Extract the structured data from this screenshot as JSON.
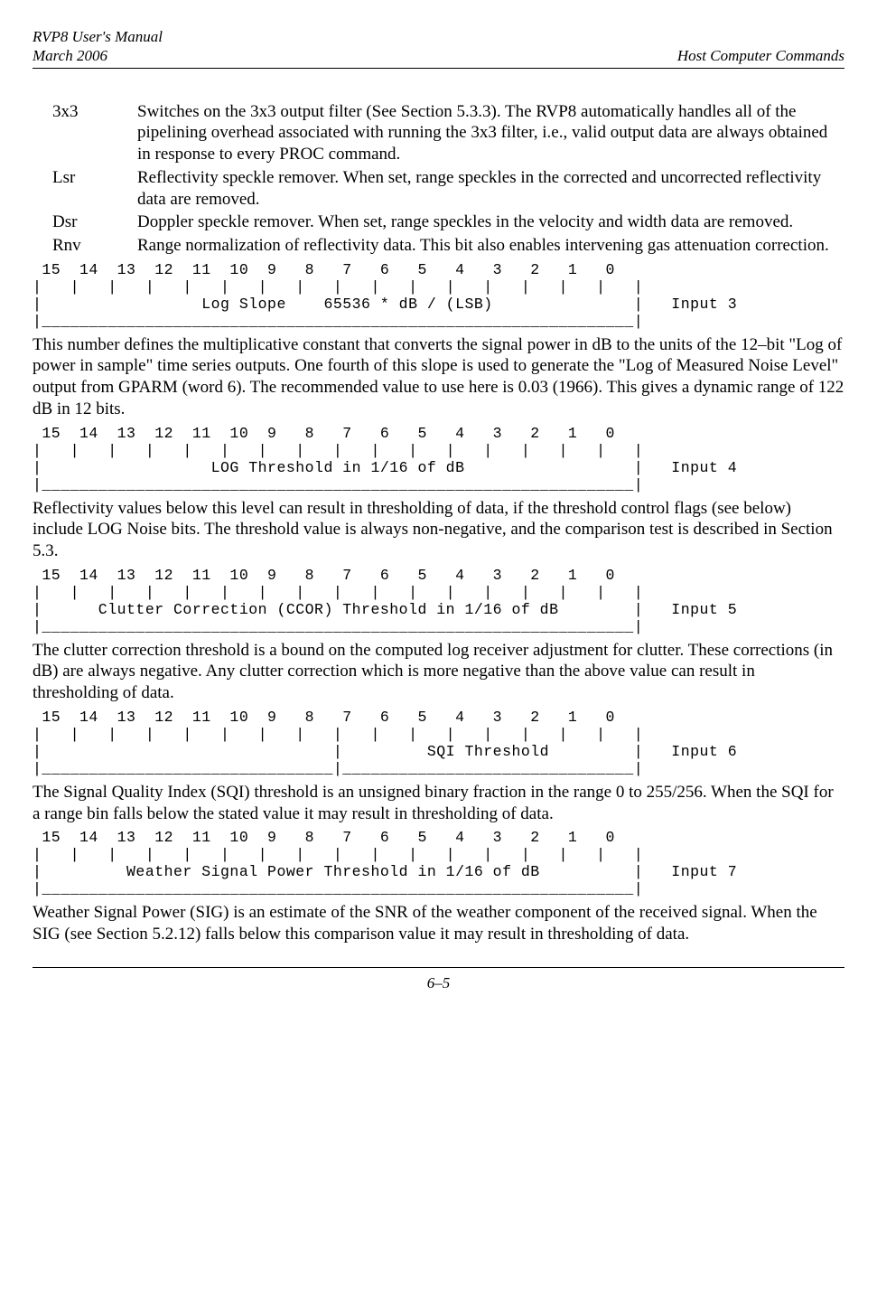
{
  "header": {
    "manual_title": "RVP8 User's Manual",
    "date": "March 2006",
    "section": "Host Computer Commands"
  },
  "definitions": [
    {
      "term": "3x3",
      "desc": "Switches on the 3x3 output filter (See Section 5.3.3).  The RVP8 automatically handles all of the pipelining overhead associated with running the 3x3 filter, i.e., valid output data are always obtained in response to every PROC command."
    },
    {
      "term": "Lsr",
      "desc": "Reflectivity speckle remover.  When set, range speckles in the corrected and uncorrected reflectivity data are removed."
    },
    {
      "term": "Dsr",
      "desc": "Doppler speckle remover.  When set, range speckles in the velocity and width data are removed."
    },
    {
      "term": "Rnv",
      "desc": "Range normalization of reflectivity data.  This bit also enables intervening gas attenuation correction."
    }
  ],
  "diagrams": {
    "header_row": " 15  14  13  12  11  10  9   8   7   6   5   4   3   2   1   0 ",
    "ticks": "|   |   |   |   |   |   |   |   |   |   |   |   |   |   |   |   |",
    "input3": "|                 Log Slope    65536 * dB / (LSB)               |   Input 3",
    "bottom": "|_______________________________________________________________|",
    "input4": "|                  LOG Threshold in 1/16 of dB                  |   Input 4",
    "input5": "|      Clutter Correction (CCOR) Threshold in 1/16 of dB        |   Input 5",
    "input6": "|                               |         SQI Threshold         |   Input 6",
    "bottom6": "|_______________________________|_______________________________|",
    "input7": "|         Weather Signal Power Threshold in 1/16 of dB          |   Input 7"
  },
  "para3": "This number defines the multiplicative constant that converts the signal power in dB to the units of the 12–bit \"Log of power in sample\" time series outputs.  One fourth of this slope is used to generate the \"Log of Measured Noise Level\" output from GPARM (word 6).  The recommended value to use here is 0.03 (1966).  This gives a dynamic range of 122 dB in 12 bits.",
  "para4": "Reflectivity values below this level can result in thresholding of data, if the threshold control flags (see below) include LOG Noise bits.  The threshold value is always non-negative, and the comparison test is described in Section 5.3.",
  "para5": "The clutter correction threshold is a bound on the computed log receiver adjustment for clutter. These corrections (in dB) are always negative.  Any clutter correction which is more negative than the above value can result in thresholding of data.",
  "para6": "The Signal Quality Index (SQI) threshold is an unsigned binary fraction in the range 0 to 255/256.  When the SQI for a range bin falls below the stated value it may result in thresholding of data.",
  "para7": "Weather Signal Power (SIG) is an estimate of the SNR of the weather component of the received signal.  When the SIG (see Section 5.2.12) falls below this comparison value it may result in thresholding of data.",
  "page_number": "6–5"
}
